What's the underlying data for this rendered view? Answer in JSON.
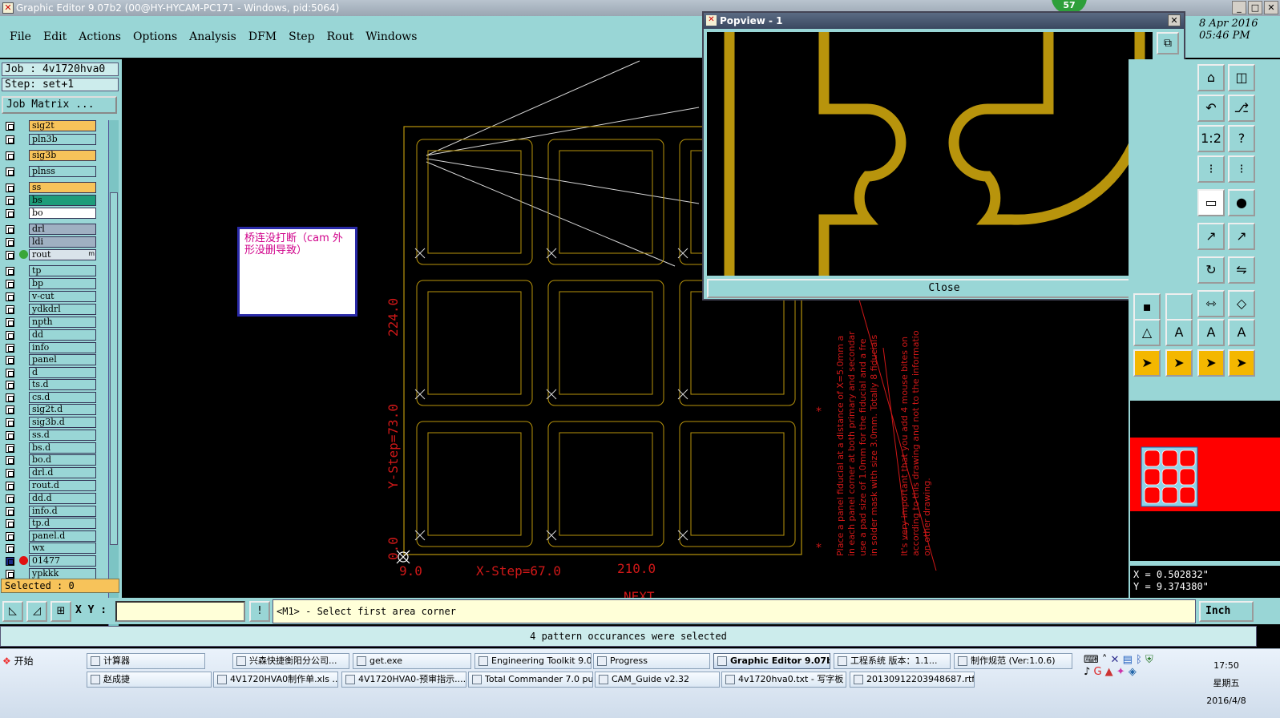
{
  "app": {
    "title": "Graphic Editor 9.07b2 (00@HY-HYCAM-PC171 - Windows, pid:5064)",
    "badge": "57",
    "date_line1": "8 Apr 2016",
    "date_line2": "05:46 PM"
  },
  "menu": [
    "File",
    "Edit",
    "Actions",
    "Options",
    "Analysis",
    "DFM",
    "Step",
    "Rout",
    "Windows"
  ],
  "left": {
    "job": "Job : 4v1720hva0",
    "step": "Step: set+1",
    "job_matrix": "Job Matrix ...",
    "selected": "Selected : 0",
    "layers": [
      {
        "name": "sig2t",
        "color": "#f7c35a"
      },
      {
        "name": "pln3b",
        "color": "#99d6d6"
      },
      {
        "name": "sig3b",
        "color": "#f7c35a"
      },
      {
        "name": "plnss",
        "color": "#99d6d6"
      },
      {
        "name": "ss",
        "color": "#f7c35a"
      },
      {
        "name": "bs",
        "color": "#1e9c7a"
      },
      {
        "name": "bo",
        "color": "#ffffff"
      },
      {
        "name": "drl",
        "color": "#9fb0c2"
      },
      {
        "name": "ldi",
        "color": "#9fb0c2"
      },
      {
        "name": "rout",
        "color": "#d9e3ea",
        "dot": "#3aa63a",
        "extra": "m"
      },
      {
        "name": "tp",
        "color": "#99d6d6"
      },
      {
        "name": "bp",
        "color": "#99d6d6"
      },
      {
        "name": "v-cut",
        "color": "#99d6d6"
      },
      {
        "name": "ydkdrl",
        "color": "#99d6d6"
      },
      {
        "name": "npth",
        "color": "#99d6d6"
      },
      {
        "name": "dd",
        "color": "#99d6d6"
      },
      {
        "name": "info",
        "color": "#99d6d6"
      },
      {
        "name": "panel",
        "color": "#99d6d6"
      },
      {
        "name": "d",
        "color": "#99d6d6"
      },
      {
        "name": "ts.d",
        "color": "#99d6d6"
      },
      {
        "name": "cs.d",
        "color": "#99d6d6"
      },
      {
        "name": "sig2t.d",
        "color": "#99d6d6"
      },
      {
        "name": "sig3b.d",
        "color": "#99d6d6"
      },
      {
        "name": "ss.d",
        "color": "#99d6d6"
      },
      {
        "name": "bs.d",
        "color": "#99d6d6"
      },
      {
        "name": "bo.d",
        "color": "#99d6d6"
      },
      {
        "name": "drl.d",
        "color": "#99d6d6"
      },
      {
        "name": "rout.d",
        "color": "#99d6d6"
      },
      {
        "name": "dd.d",
        "color": "#99d6d6"
      },
      {
        "name": "info.d",
        "color": "#99d6d6"
      },
      {
        "name": "tp.d",
        "color": "#99d6d6"
      },
      {
        "name": "panel.d",
        "color": "#99d6d6"
      },
      {
        "name": "wx",
        "color": "#99d6d6"
      },
      {
        "name": "01477",
        "color": "#99d6d6",
        "dot": "#e01010",
        "checked": true
      },
      {
        "name": "ypkkk",
        "color": "#99d6d6"
      }
    ]
  },
  "canvas": {
    "note": "桥连没打断（cam 外形没删导致）",
    "label_y224": "224.0",
    "label_ystep": "Y-Step=73.0",
    "label_x0": "9.0",
    "label_xstep": "X-Step=67.0",
    "label_x210": "210.0",
    "label_zero": "0.0",
    "label_next": "NEXT",
    "rot_text1": "Place a panel fiducial at a distance of X=5.0mm a",
    "rot_text2": "in each panel corner at both primary and secondar",
    "rot_text3": "use a pad size of 1.0mm for the fiducial and a fre",
    "rot_text4": "in solder mask with size 3.0mm. Totally 8 fiducials",
    "rot_text5": "It's very important that you add 4 mouse bites on",
    "rot_text6": "according to this drawing and not to the informatio",
    "rot_text7": "on other drawing."
  },
  "popview": {
    "title": "Popview - 1",
    "close_label": "Close"
  },
  "coords": {
    "x": "X = 0.502832\"",
    "y": "Y = 9.374380\""
  },
  "cmd": {
    "xy_label": "X Y :",
    "xy_value": "",
    "prompt": "<M1> - Select first area corner",
    "units": "Inch",
    "status": "4 pattern occurances were selected"
  },
  "taskbar": {
    "start": "开始",
    "tasks_row1": [
      "计算器",
      "兴森快捷衡阳分公司...",
      "get.exe",
      "Engineering Toolkit 9.0...",
      "Progress",
      "Graphic Editor 9.07b...",
      "工程系统  版本：1.1...",
      "制作规范 (Ver:1.0.6)"
    ],
    "tasks_row2": [
      "赵成捷",
      "4V1720HVA0制作单.xls ...",
      "4V1720HVA0-预审指示....",
      "Total Commander 7.0 pu...",
      "CAM_Guide v2.32",
      "4v1720hva0.txt - 写字板",
      "20130912203948687.rtf..."
    ],
    "time": "17:50",
    "weekday": "星期五",
    "date": "2016/4/8"
  },
  "colors": {
    "panel_bg": "#99d6d6",
    "trace_gold": "#b8940c",
    "dim_red": "#d01818"
  }
}
